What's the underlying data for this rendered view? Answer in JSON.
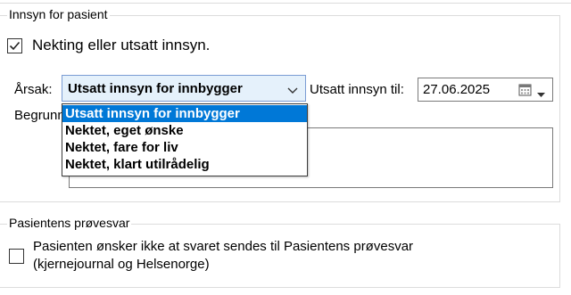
{
  "innsyn_section": {
    "title": "Innsyn for pasient",
    "denial_checkbox_label": "Nekting eller utsatt innsyn.",
    "denial_checked": true,
    "reason_label": "Årsak:",
    "reason_selected": "Utsatt innsyn for innbygger",
    "reason_options": [
      "Utsatt innsyn for innbygger",
      "Nektet, eget ønske",
      "Nektet, fare for liv",
      "Nektet, klart utilrådelig"
    ],
    "delay_until_label": "Utsatt innsyn til:",
    "delay_until_value": "27.06.2025",
    "justification_label": "Begrunn"
  },
  "provesvar_section": {
    "title": "Pasientens prøvesvar",
    "checkbox_label_line1": "Pasienten ønsker ikke at svaret sendes til Pasientens prøvesvar",
    "checkbox_label_line2": "(kjernejournal og Helsenorge)",
    "checked": false
  },
  "colors": {
    "accent": "#0078d7",
    "combo_bg": "#e5f1fb",
    "combo_border": "#7a9cd3"
  }
}
